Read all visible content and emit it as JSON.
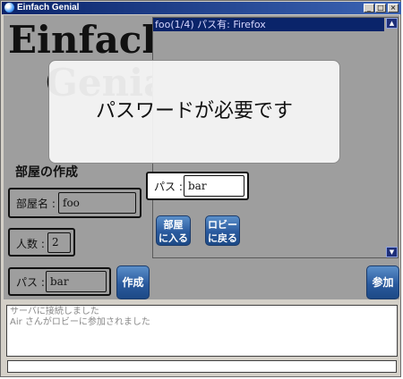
{
  "window": {
    "title": "Einfach Genial",
    "buttons": {
      "minimize": "_",
      "maximize": "□",
      "close": "×"
    }
  },
  "logo": {
    "line1": "Einfach",
    "line2": "Genial"
  },
  "room_list": {
    "selected_room": "foo(1/4) パス有: Firefox"
  },
  "join_area": {
    "pass_label": "パス :",
    "pass_value": "bar",
    "enter_room_label_1": "部屋",
    "enter_room_label_2": "に入る",
    "back_lobby_label_1": "ロビー",
    "back_lobby_label_2": "に戻る"
  },
  "create_room": {
    "title": "部屋の作成",
    "room_name_label": "部屋名 :",
    "room_name_value": "foo",
    "players_label": "人数 :",
    "players_value": "2",
    "pass_label": "パス :",
    "pass_value": "bar",
    "create_button": "作成"
  },
  "join_button": "参加",
  "overlay": {
    "message": "パスワードが必要です"
  },
  "log": {
    "lines": [
      "サーバに接続しました",
      "Air さんがロビーに参加されました"
    ]
  },
  "chat_input": {
    "value": ""
  },
  "colors": {
    "titlebar": "#0a246a",
    "content_bg": "#9e9e9e",
    "button_blue": "#2a5a9e",
    "selection": "#0a246a"
  }
}
